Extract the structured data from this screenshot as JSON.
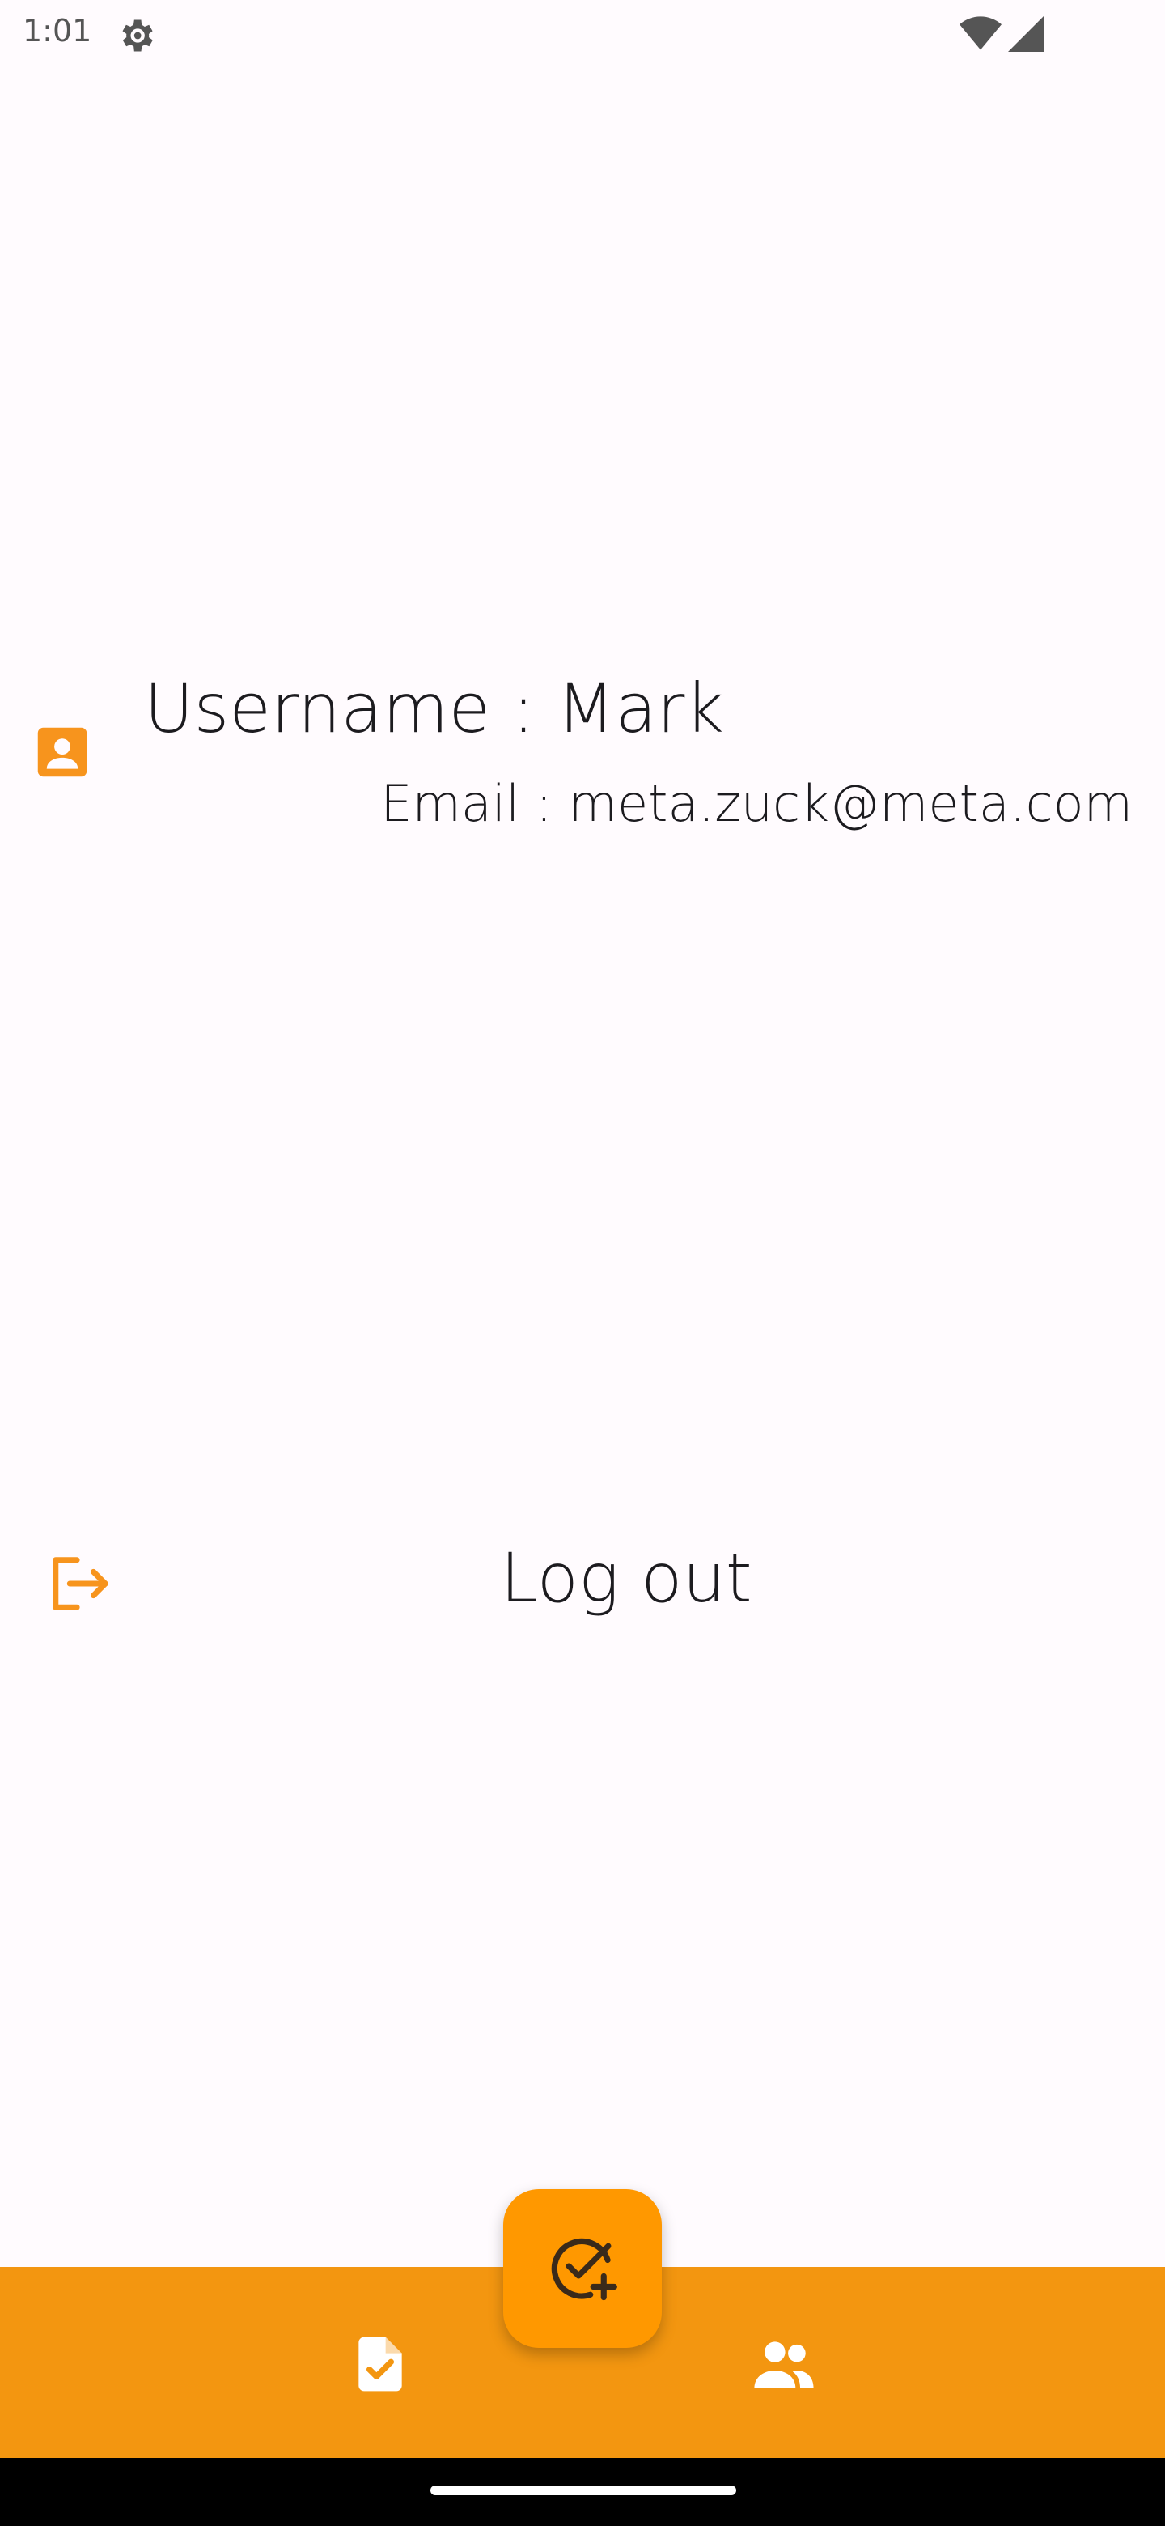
{
  "status_bar": {
    "time": "1:01",
    "icons": [
      "gear-icon",
      "wifi-icon",
      "signal-icon"
    ]
  },
  "profile": {
    "username": "Username : Mark",
    "email": "Email : meta.zuck@meta.com",
    "icon": "contact-card-icon"
  },
  "logout": {
    "label": "Log out",
    "icon": "logout-icon"
  },
  "bottom_nav": {
    "items": [
      {
        "icon": "task-document-icon"
      },
      {
        "icon": "people-icon"
      }
    ]
  },
  "fab": {
    "icon": "add-task-icon"
  },
  "colors": {
    "accent": "#F39610",
    "fab": "#FF9800",
    "icon_accent": "#F7941D",
    "background": "#FFFBFE",
    "text": "#1C1B1F"
  }
}
